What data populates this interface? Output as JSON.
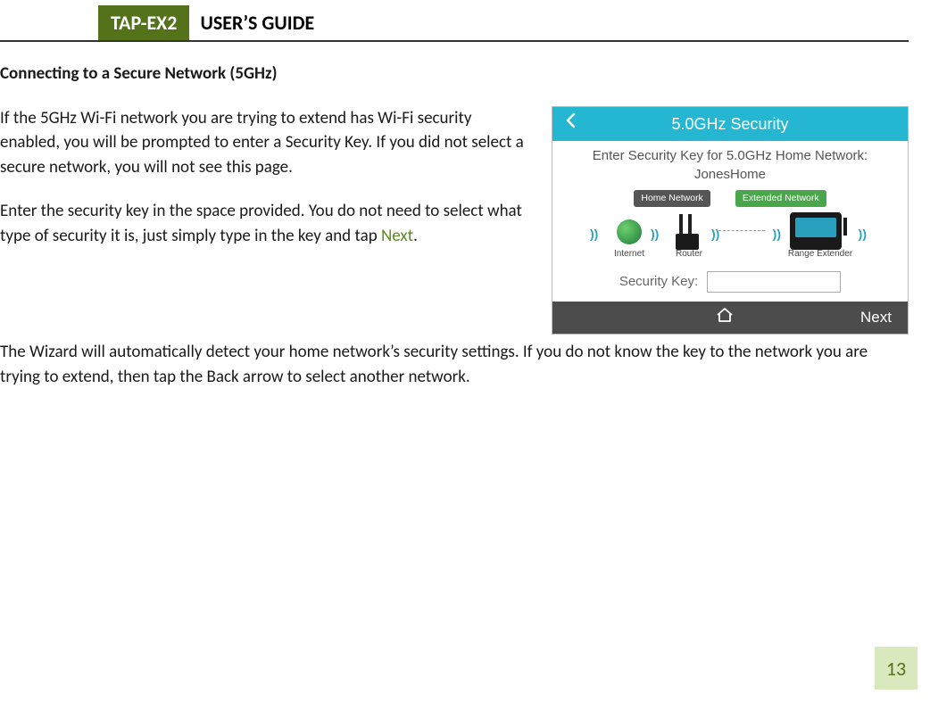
{
  "header": {
    "tag": "TAP-EX2",
    "title": "USER’S GUIDE"
  },
  "section_title": "Connecting to a Secure Network (5GHz)",
  "para1": "If the 5GHz Wi-Fi network you are trying to extend has Wi-Fi security enabled, you will be prompted to enter a Security Key. If you did not select a secure network, you will not see this page.",
  "para2a": "Enter the security key in the space provided. You do not need to select what type of security it is, just simply type in the key and tap ",
  "para2_next": "Next",
  "para2b": ".",
  "para3": "The Wizard will automatically detect your home network’s security settings. If you do not know the key to the network you are trying to extend, then tap the Back arrow to select another network.",
  "screenshot": {
    "top_title": "5.0GHz Security",
    "prompt_line1": "Enter Security Key for 5.0GHz Home Network:",
    "prompt_line2": "JonesHome",
    "tag_home": "Home Network",
    "tag_ext": "Extended Network",
    "label_internet": "Internet",
    "label_router": "Router",
    "label_range": "Range Extender",
    "field_label": "Security Key:",
    "next_label": "Next"
  },
  "page_number": "13"
}
